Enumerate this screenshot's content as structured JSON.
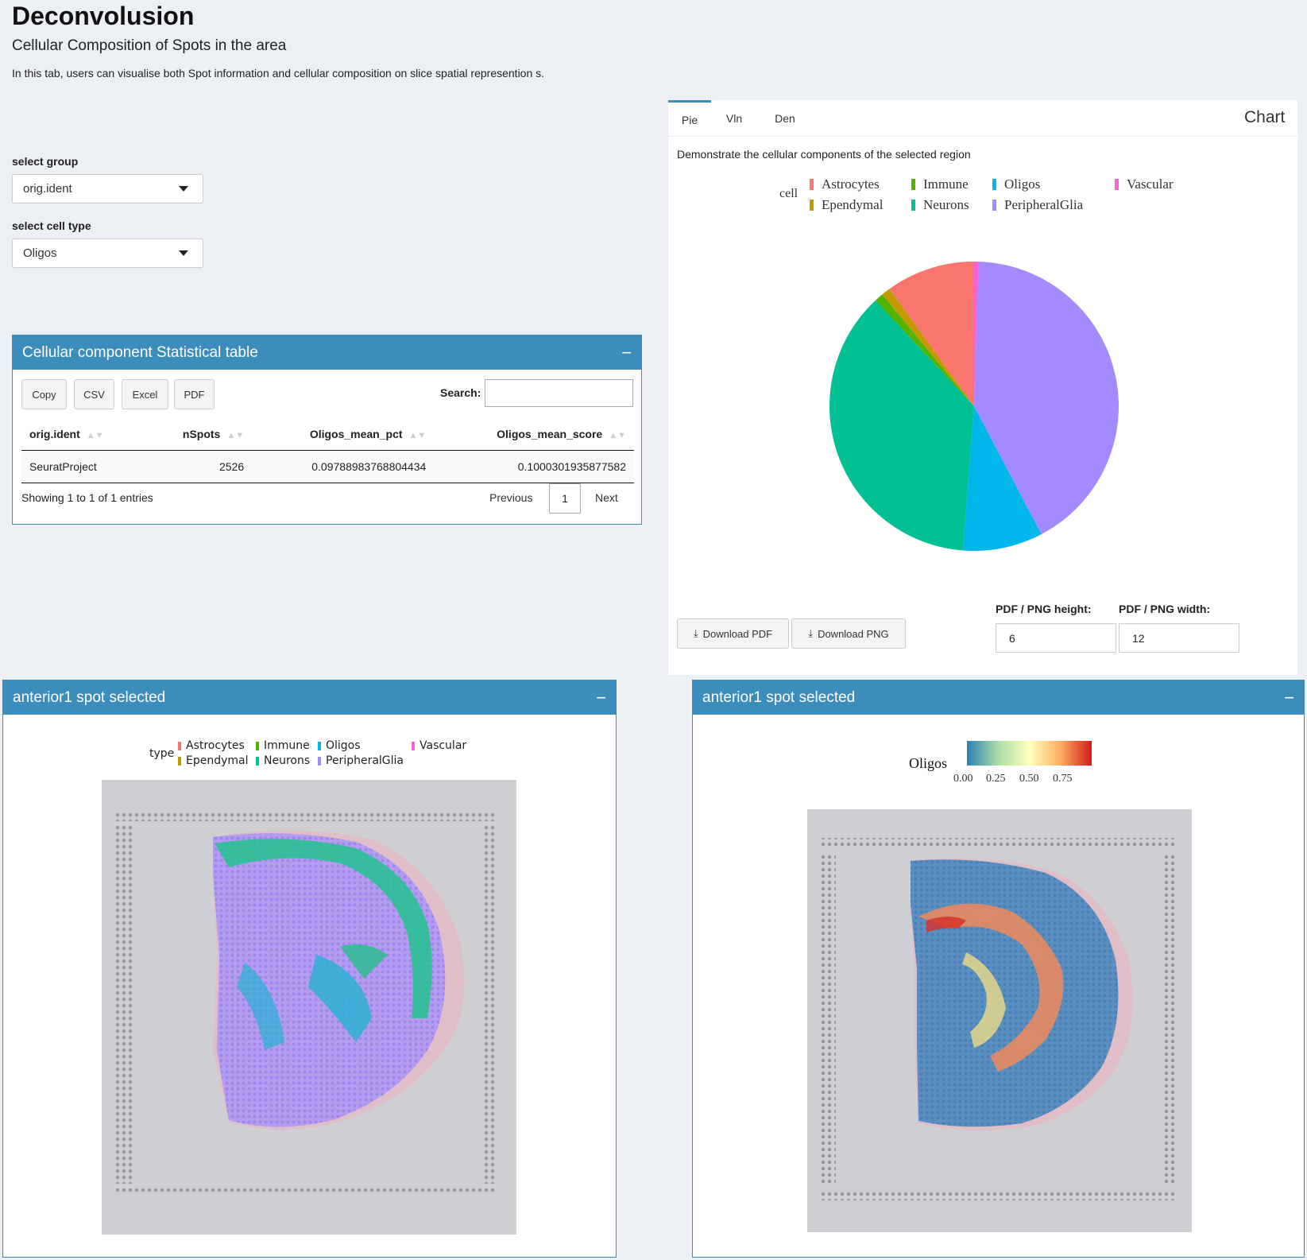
{
  "page": {
    "title": "Deconvolusion",
    "subtitle": "Cellular Composition of Spots in the area",
    "description": "In this tab, users can visualise both Spot information and cellular composition on slice spatial represention s."
  },
  "controls": {
    "group_label": "select group",
    "group_value": "orig.ident",
    "celltype_label": "select cell type",
    "celltype_value": "Oligos"
  },
  "stat_table": {
    "title": "Cellular component Statistical table",
    "collapse": "−",
    "buttons": [
      "Copy",
      "CSV",
      "Excel",
      "PDF"
    ],
    "search_label": "Search:",
    "columns": [
      "orig.ident",
      "nSpots",
      "Oligos_mean_pct",
      "Oligos_mean_score"
    ],
    "rows": [
      [
        "SeuratProject",
        "2526",
        "0.09788983768804434",
        "0.1000301935877582"
      ]
    ],
    "info": "Showing 1 to 1 of 1 entries",
    "pager": {
      "prev": "Previous",
      "page": "1",
      "next": "Next"
    }
  },
  "chart_panel": {
    "tabs": [
      "Pie",
      "Vln",
      "Den"
    ],
    "active_tab": "Pie",
    "title": "Chart",
    "caption": "Demonstrate the cellular components of the selected region",
    "legend_title": "cell",
    "download_pdf": "Download PDF",
    "download_png": "Download PNG",
    "height_label": "PDF / PNG height:",
    "height_value": "6",
    "width_label": "PDF / PNG width:",
    "width_value": "12"
  },
  "chart_data": {
    "type": "pie",
    "legend_title": "cell",
    "categories": [
      "Astrocytes",
      "Ependymal",
      "Immune",
      "Neurons",
      "Oligos",
      "PeripheralGlia",
      "Vascular"
    ],
    "values": [
      0.1,
      0.01,
      0.01,
      0.37,
      0.09,
      0.42,
      0.005
    ],
    "colors": {
      "Astrocytes": "#f8766d",
      "Ependymal": "#c49a00",
      "Immune": "#53b400",
      "Neurons": "#00c094",
      "Oligos": "#00b6eb",
      "PeripheralGlia": "#a58aff",
      "Vascular": "#fb61d7"
    }
  },
  "spatial_left": {
    "title": "anterior1 spot selected",
    "collapse": "−",
    "legend_title": "type",
    "legend": [
      "Astrocytes",
      "Immune",
      "Oligos",
      "Vascular",
      "Ependymal",
      "Neurons",
      "PeripheralGlia"
    ],
    "legend_colors": [
      "#f8766d",
      "#53b400",
      "#00b6eb",
      "#fb61d7",
      "#c49a00",
      "#00c094",
      "#a58aff"
    ]
  },
  "spatial_right": {
    "title": "anterior1 spot selected",
    "collapse": "−",
    "scale_title": "Oligos",
    "scale_ticks": [
      "0.00",
      "0.25",
      "0.50",
      "0.75"
    ]
  }
}
